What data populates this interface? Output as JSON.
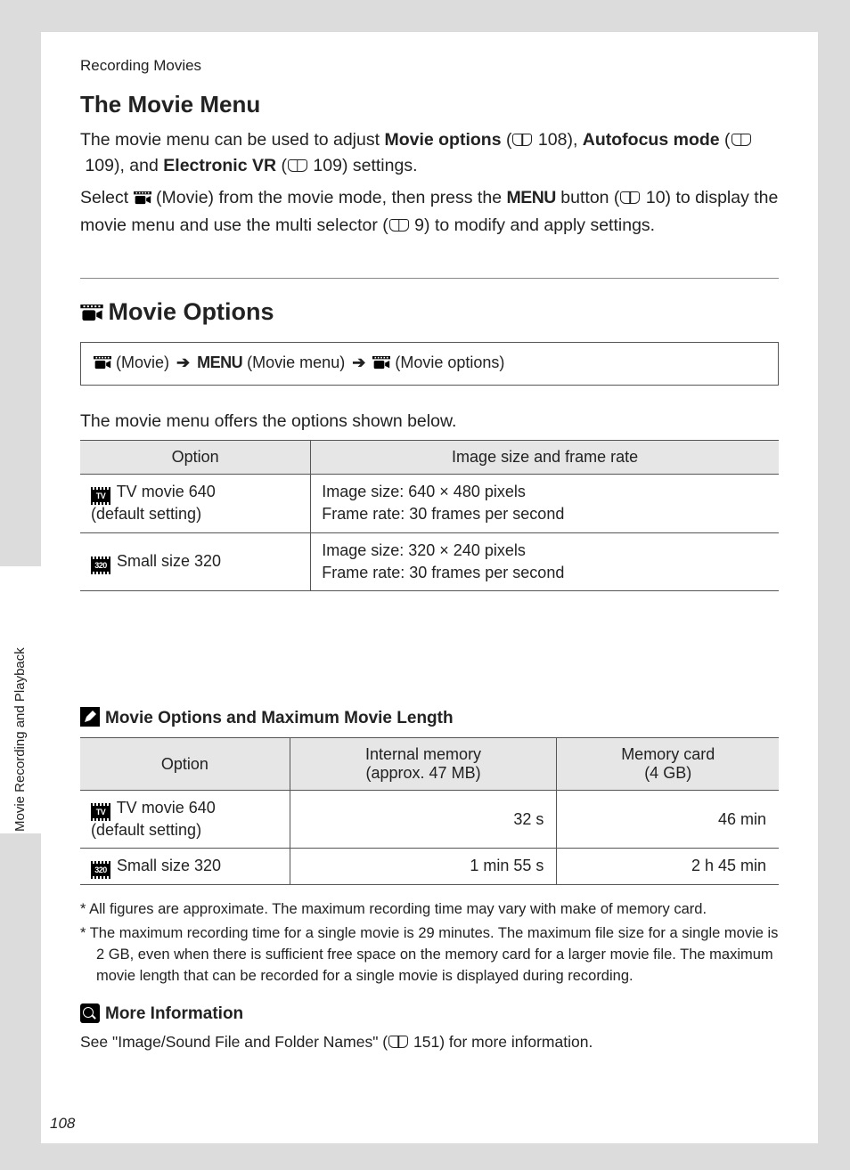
{
  "section_label": "Recording Movies",
  "side_tab": "Movie Recording and Playback",
  "page_number": "108",
  "heading1": "The Movie Menu",
  "intro": {
    "p1_pre": "The movie menu can be used to adjust ",
    "opt1": "Movie options",
    "p1_ref1_page": "108",
    "p1_mid1": ", ",
    "opt2": "Autofocus mode",
    "p1_ref2_page": "109",
    "p1_mid2": ", and ",
    "opt3": "Electronic VR",
    "p1_ref3_page": "109",
    "p1_post": " settings.",
    "p2_pre": "Select ",
    "p2_movie_label": " (Movie) from the movie mode, then press the ",
    "menu_word": "MENU",
    "p2_button_label": " button (",
    "p2_ref1_page": "10",
    "p2_mid": ") to display the movie menu and use the multi selector (",
    "p2_ref2_page": "9",
    "p2_post": ") to modify and apply settings."
  },
  "heading2": "Movie Options",
  "breadcrumb": {
    "movie_label": "(Movie)",
    "menu_word": "MENU",
    "menu_label": "(Movie menu)",
    "options_label": "(Movie options)"
  },
  "table_intro": "The movie menu offers the options shown below.",
  "options_table": {
    "col1": "Option",
    "col2": "Image size and frame rate",
    "rows": [
      {
        "icon_label": "TV",
        "name": "TV movie 640",
        "sub": "(default setting)",
        "line1": "Image size: 640 × 480 pixels",
        "line2": "Frame rate: 30 frames per second"
      },
      {
        "icon_label": "320",
        "name": "Small size 320",
        "sub": "",
        "line1": "Image size: 320 × 240 pixels",
        "line2": "Frame rate: 30 frames per second"
      }
    ]
  },
  "note1_title": "Movie Options and Maximum Movie Length",
  "length_table": {
    "col1": "Option",
    "col2a": "Internal memory",
    "col2b": "(approx. 47 MB)",
    "col3a": "Memory card",
    "col3b": "(4 GB)",
    "rows": [
      {
        "icon_label": "TV",
        "name": "TV movie 640",
        "sub": "(default setting)",
        "internal": "32 s",
        "card": "46 min"
      },
      {
        "icon_label": "320",
        "name": "Small size 320",
        "sub": "",
        "internal": "1 min 55 s",
        "card": "2 h 45 min"
      }
    ]
  },
  "footnotes": {
    "f1": "*  All figures are approximate. The maximum recording time may vary with make of memory card.",
    "f2": "*  The maximum recording time for a single movie is 29 minutes. The maximum file size for a single movie is 2 GB, even when there is sufficient free space on the memory card for a larger movie file. The maximum movie length that can be recorded for a single movie is displayed during recording."
  },
  "more_info_title": "More Information",
  "more_info_text_pre": "See \"Image/Sound File and Folder Names\" (",
  "more_info_page": "151",
  "more_info_text_post": ") for more information."
}
